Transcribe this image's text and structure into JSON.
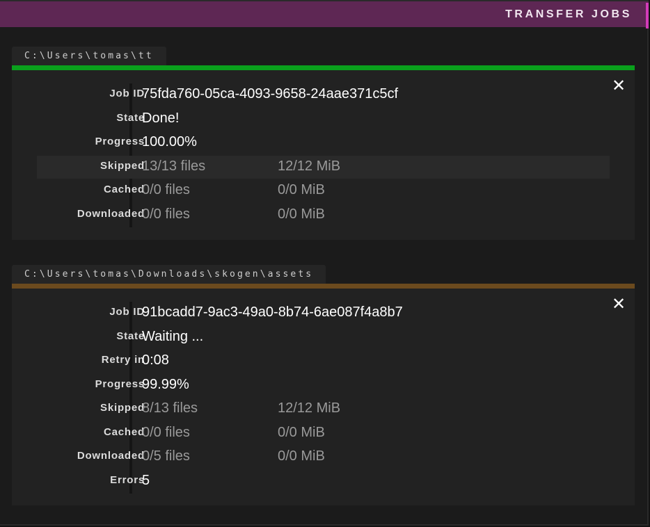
{
  "header": {
    "title": "TRANSFER JOBS",
    "accent_color": "#d23bb8",
    "background": "#5e2754"
  },
  "jobs": [
    {
      "path": "C:\\Users\\tomas\\tt",
      "status_color": "#0aa01c",
      "close_icon": "close-icon",
      "rows": {
        "job_id": {
          "label": "Job ID",
          "value": "75fda760-05ca-4093-9658-24aae371c5cf"
        },
        "state": {
          "label": "State",
          "value": "Done!"
        },
        "progress": {
          "label": "Progress",
          "value": "100.00%"
        },
        "skipped": {
          "label": "Skipped",
          "files": "13/13 files",
          "size": "12/12 MiB"
        },
        "cached": {
          "label": "Cached",
          "files": "0/0 files",
          "size": "0/0 MiB"
        },
        "downloaded": {
          "label": "Downloaded",
          "files": "0/0 files",
          "size": "0/0 MiB"
        }
      }
    },
    {
      "path": "C:\\Users\\tomas\\Downloads\\skogen\\assets",
      "status_color": "#6b4a1e",
      "close_icon": "close-icon",
      "rows": {
        "job_id": {
          "label": "Job ID",
          "value": "91bcadd7-9ac3-49a0-8b74-6ae087f4a8b7"
        },
        "state": {
          "label": "State",
          "value": "Waiting ..."
        },
        "retry": {
          "label": "Retry in",
          "value": "0:08"
        },
        "progress": {
          "label": "Progress",
          "value": "99.99%"
        },
        "skipped": {
          "label": "Skipped",
          "files": "8/13 files",
          "size": "12/12 MiB"
        },
        "cached": {
          "label": "Cached",
          "files": "0/0 files",
          "size": "0/0 MiB"
        },
        "downloaded": {
          "label": "Downloaded",
          "files": "0/5 files",
          "size": "0/0 MiB"
        },
        "errors": {
          "label": "Errors",
          "value": "5"
        }
      }
    }
  ]
}
